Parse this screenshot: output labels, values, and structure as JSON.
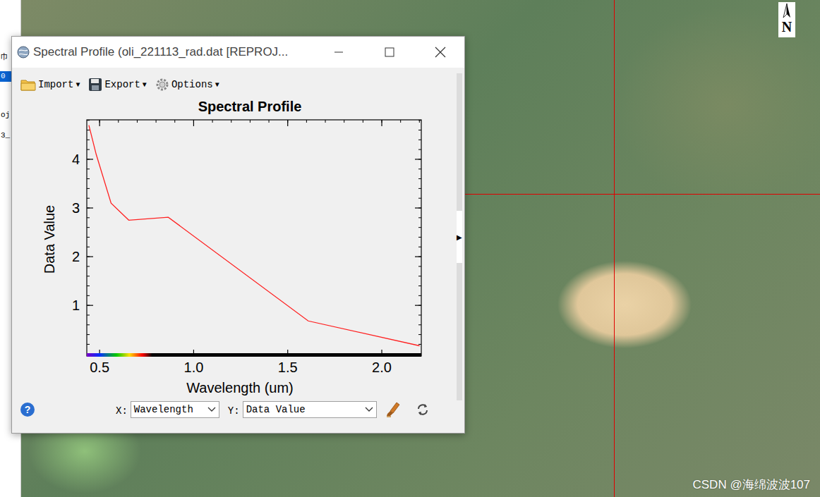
{
  "left_panel": {
    "items": [
      {
        "label": "巾",
        "selected": false
      },
      {
        "label": "0",
        "selected": true
      },
      {
        "label": "oj",
        "selected": false
      },
      {
        "label": "3_",
        "selected": false
      }
    ]
  },
  "window": {
    "title": "Spectral Profile (oli_221113_rad.dat [REPROJ..."
  },
  "toolbar": [
    {
      "label": "Import",
      "menu": "▼",
      "kind": "folder"
    },
    {
      "label": "Export",
      "menu": "▼",
      "kind": "save"
    },
    {
      "label": "Options",
      "menu": "▼",
      "kind": "gear"
    }
  ],
  "chart": {
    "title": "Spectral Profile",
    "x_label": "Wavelength (um)",
    "y_label": "Data Value",
    "x_ticks": [
      "0.5",
      "1.0",
      "1.5",
      "2.0"
    ],
    "y_ticks": [
      "1",
      "2",
      "3",
      "4"
    ],
    "series": [
      {
        "x": [
          0.443,
          0.482,
          0.561,
          0.655,
          0.865,
          1.609,
          2.201
        ],
        "y": [
          4.7,
          4.1,
          3.1,
          2.75,
          2.81,
          0.68,
          0.17
        ]
      }
    ]
  },
  "side_handle": {
    "arrow": "▶"
  },
  "controls": {
    "help": "?",
    "x_label": "X:",
    "x_value": "Wavelength",
    "y_label": "Y:",
    "y_value": "Data Value"
  },
  "map": {
    "north_label": "N",
    "watermark": "CSDN @海绵波波107"
  }
}
